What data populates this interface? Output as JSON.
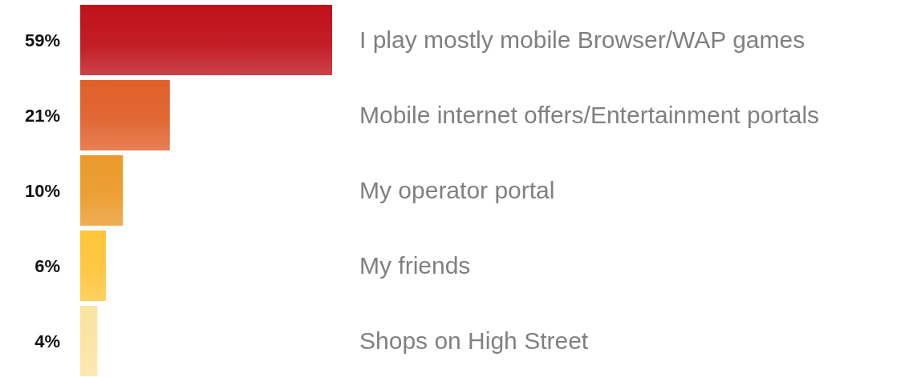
{
  "chart_data": {
    "type": "bar",
    "orientation": "horizontal",
    "categories": [
      "I play mostly mobile Browser/WAP games",
      "Mobile internet offers/Entertainment portals",
      "My operator portal",
      "My friends",
      "Shops on High Street"
    ],
    "values": [
      59,
      21,
      10,
      6,
      4
    ],
    "colors": [
      "#c0111b",
      "#e0602a",
      "#eb9a2a",
      "#ffc53a",
      "#fbe3a0"
    ],
    "xlim": [
      0,
      59
    ],
    "value_labels": [
      "59%",
      "21%",
      "10%",
      "6%",
      "4%"
    ]
  }
}
